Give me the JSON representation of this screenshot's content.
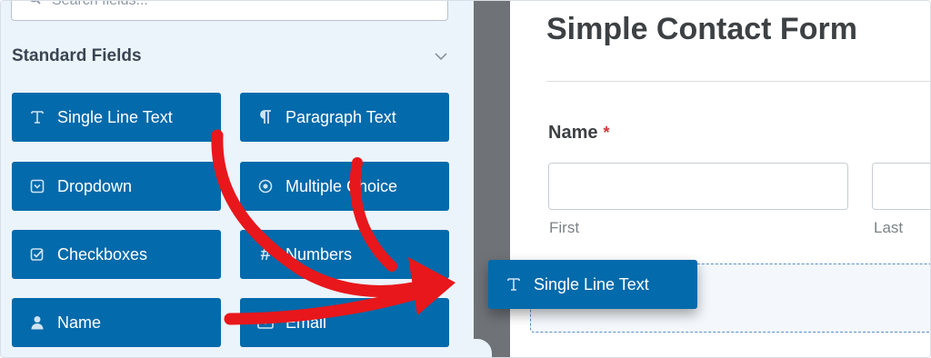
{
  "search": {
    "placeholder": "Search fields..."
  },
  "section": {
    "title": "Standard Fields"
  },
  "fields": [
    {
      "label": "Single Line Text",
      "icon": "text-field-icon"
    },
    {
      "label": "Paragraph Text",
      "icon": "paragraph-icon"
    },
    {
      "label": "Dropdown",
      "icon": "dropdown-icon"
    },
    {
      "label": "Multiple Choice",
      "icon": "radio-icon"
    },
    {
      "label": "Checkboxes",
      "icon": "checkbox-icon"
    },
    {
      "label": "Numbers",
      "icon": "hash-icon"
    },
    {
      "label": "Name",
      "icon": "user-icon"
    },
    {
      "label": "Email",
      "icon": "envelope-icon"
    }
  ],
  "form": {
    "title": "Simple Contact Form",
    "name_label": "Name",
    "required_mark": "*",
    "first_sublabel": "First",
    "last_sublabel": "Last"
  },
  "drag": {
    "label": "Single Line Text",
    "icon": "text-field-icon"
  },
  "colors": {
    "button_blue": "#036aab",
    "panel_bg": "#ebf3fb",
    "gutter": "#6f7378",
    "arrow_red": "#e8171b",
    "required_red": "#d63638"
  }
}
